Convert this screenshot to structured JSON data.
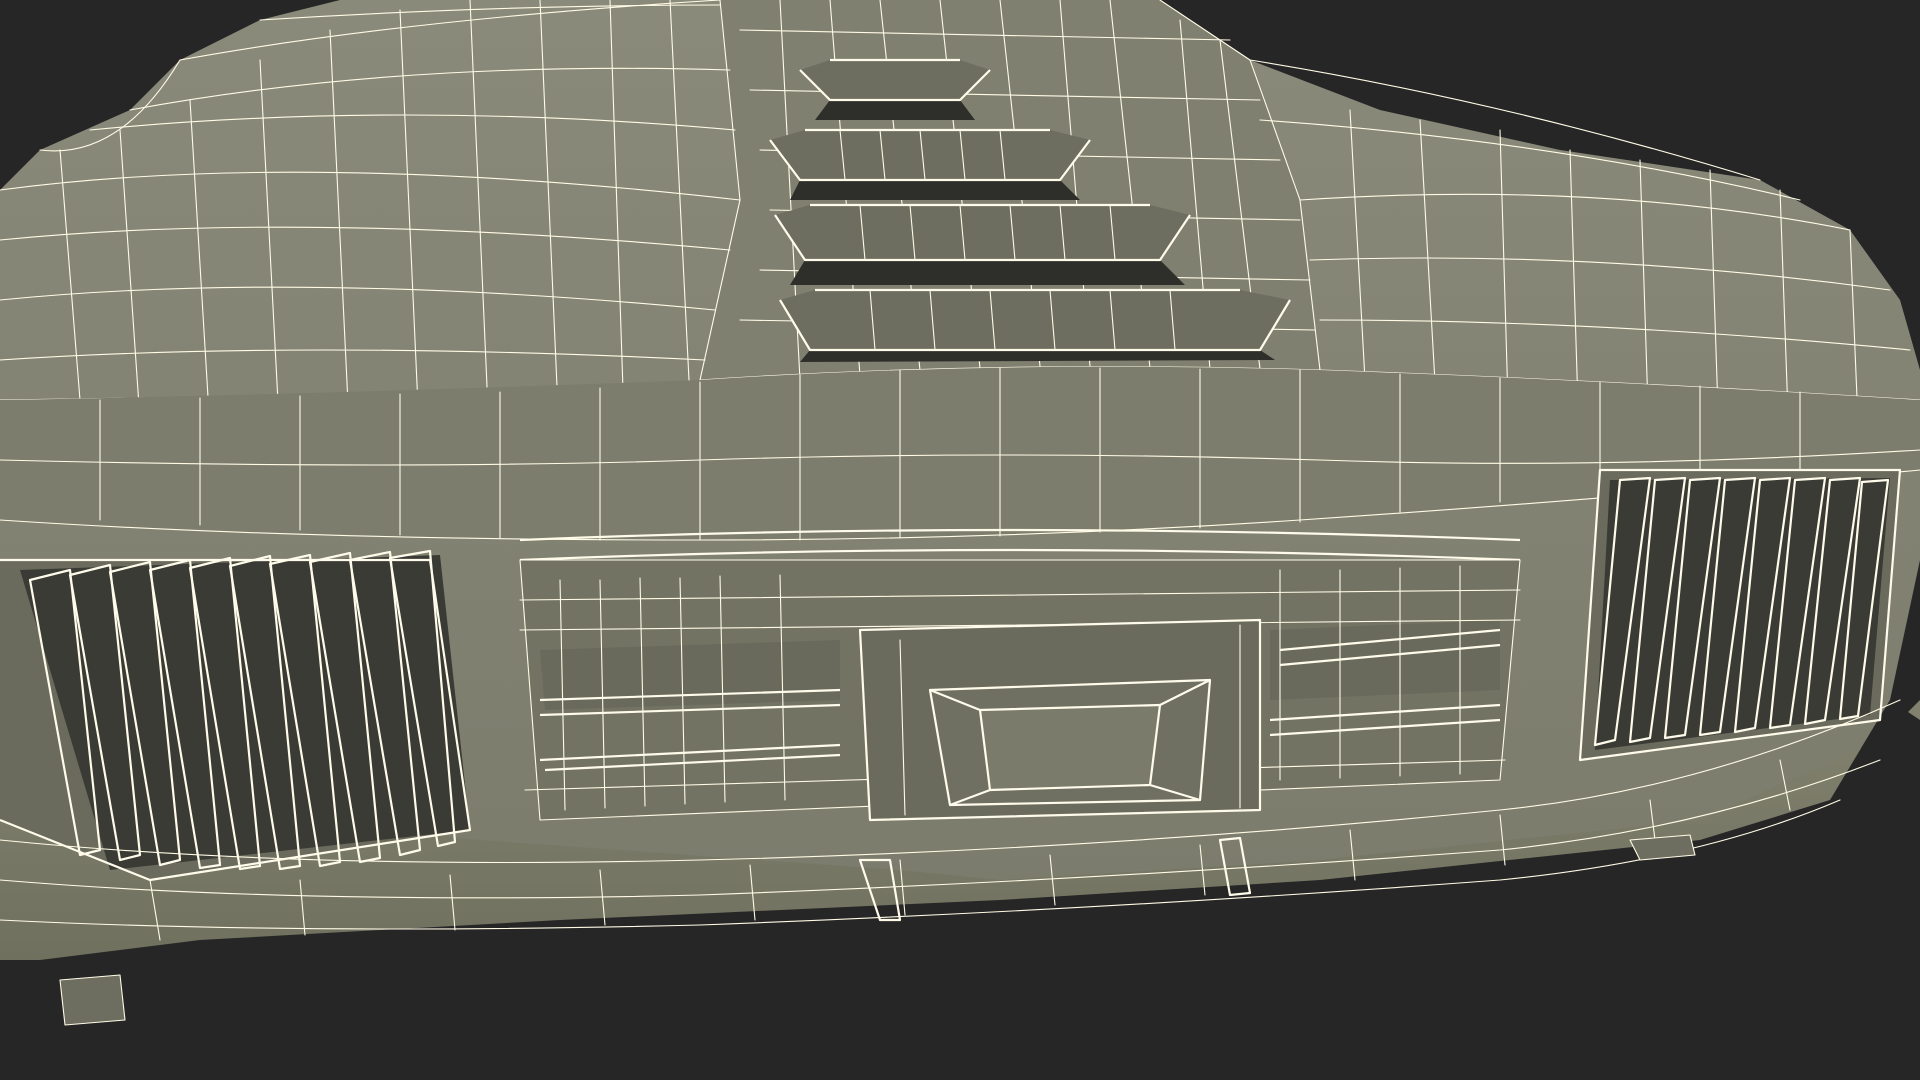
{
  "scene": {
    "background_color": "#262626",
    "surface_color": "#7f7f70",
    "surface_light": "#8d8d7d",
    "surface_dark": "#6b6b5e",
    "wire_color": "#fffbe6",
    "render_mode": "wireframe-on-shaded",
    "subject": "car-rear-3d-model"
  }
}
